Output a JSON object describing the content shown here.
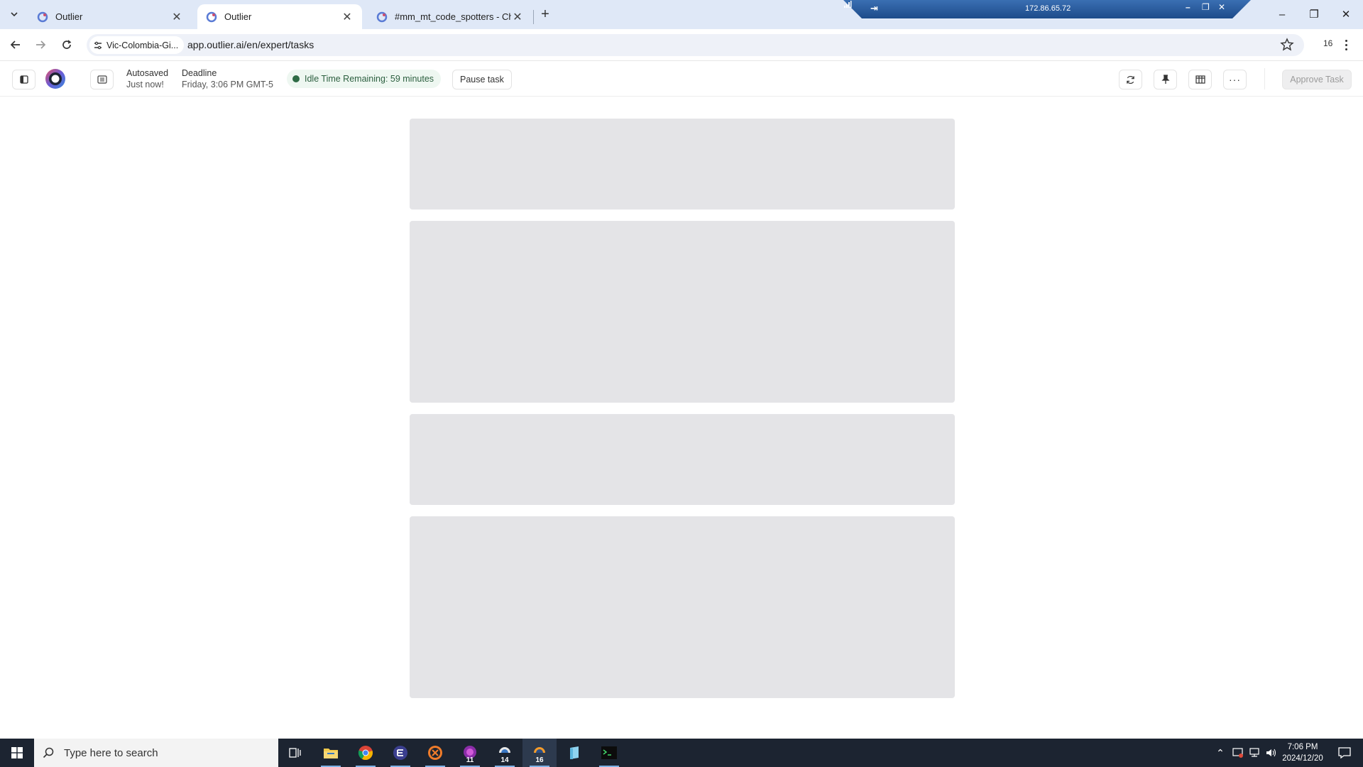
{
  "browser": {
    "tabs": [
      {
        "title": "Outlier",
        "active": false
      },
      {
        "title": "Outlier",
        "active": true
      },
      {
        "title": "#mm_mt_code_spotters - Chat",
        "active": false
      }
    ],
    "remote_ip": "172.86.65.72",
    "site_chip": "Vic-Colombia-Gi...",
    "url": "app.outlier.ai/en/expert/tasks",
    "profile_count": "16"
  },
  "header": {
    "autosave_title": "Autosaved",
    "autosave_time": "Just now!",
    "deadline_title": "Deadline",
    "deadline_value": "Friday, 3:06 PM GMT-5",
    "idle_text": "Idle Time Remaining: 59 minutes",
    "pause_label": "Pause task",
    "approve_label": "Approve Task"
  },
  "taskbar": {
    "search_placeholder": "Type here to search",
    "badges": [
      "11",
      "14",
      "16"
    ],
    "time": "7:06 PM",
    "date": "2024/12/20"
  },
  "colors": {
    "tabstrip": "#dfe8f7",
    "skeleton": "#e4e4e7",
    "idle_dot": "#2e6b45",
    "taskbar": "#1c2431"
  },
  "icons": {
    "header_left": [
      "sidebar-toggle-icon",
      "outlier-logo-icon",
      "document-panel-icon"
    ],
    "header_right": [
      "refresh-icon",
      "pin-icon",
      "columns-icon",
      "more-icon"
    ]
  }
}
